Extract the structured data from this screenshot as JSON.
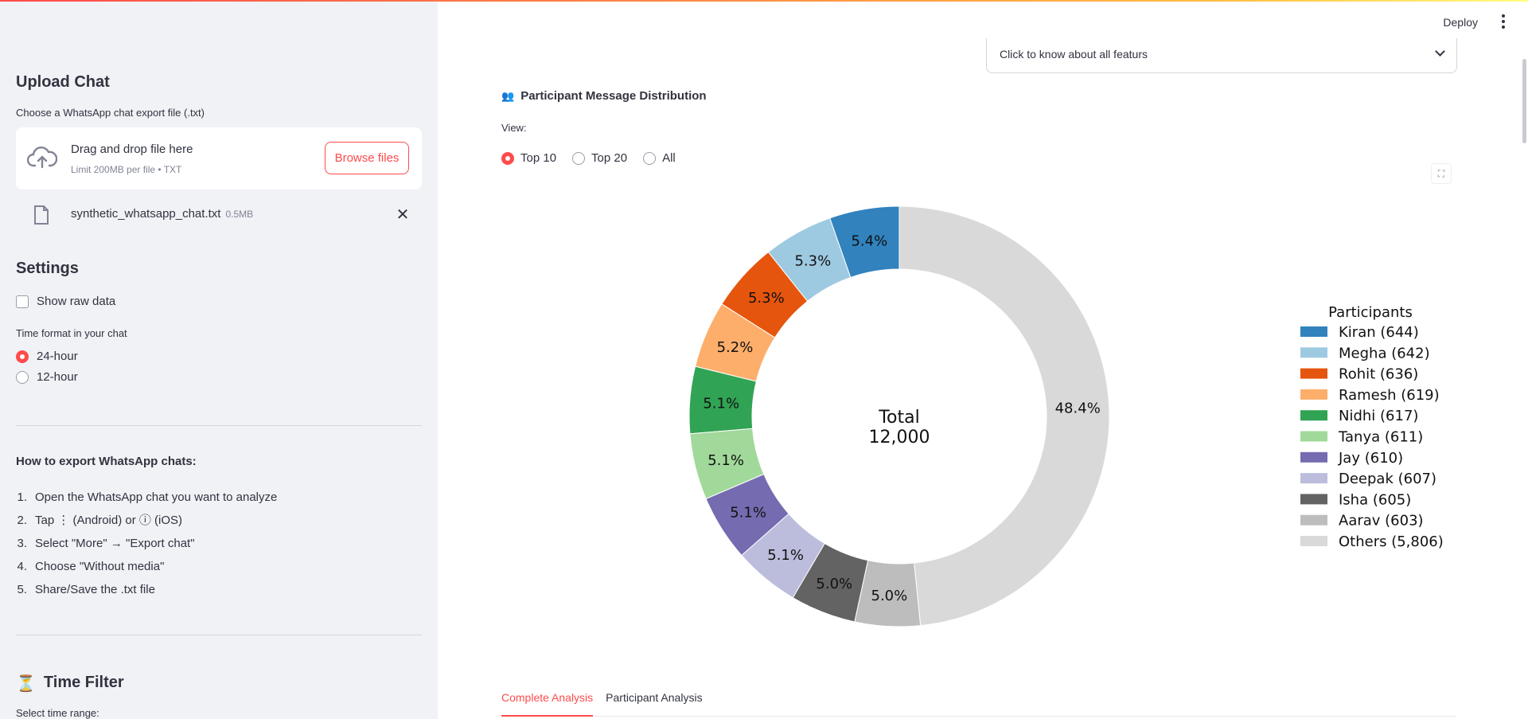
{
  "sidebar": {
    "upload_heading": "Upload Chat",
    "upload_label": "Choose a WhatsApp chat export file (.txt)",
    "dropzone_title": "Drag and drop file here",
    "dropzone_sub": "Limit 200MB per file • TXT",
    "browse_label": "Browse files",
    "file_name": "synthetic_whatsapp_chat.txt",
    "file_size": "0.5MB",
    "settings_heading": "Settings",
    "show_raw_label": "Show raw data",
    "time_format_label": "Time format in your chat",
    "time_options": [
      "24-hour",
      "12-hour"
    ],
    "time_selected": "24-hour",
    "export_heading": "How to export WhatsApp chats:",
    "steps": [
      "Open the WhatsApp chat you want to analyze",
      "Tap ⋮ (Android) or ⓘ (iOS)",
      "Select \"More\" → \"Export chat\"",
      "Choose \"Without media\"",
      "Share/Save the .txt file"
    ],
    "time_filter_heading": "Time Filter",
    "time_filter_icon": "⏳",
    "time_range_label": "Select time range:"
  },
  "header": {
    "deploy_label": "Deploy"
  },
  "main": {
    "expander_label": "Click to know about all featurs",
    "section_icon": "👥",
    "section_title": "Participant Message Distribution",
    "view_label": "View:",
    "view_options": [
      "Top 10",
      "Top 20",
      "All"
    ],
    "view_selected": "Top 10",
    "tabs": [
      "Complete Analysis",
      "Participant Analysis"
    ],
    "active_tab": "Complete Analysis"
  },
  "chart_data": {
    "type": "pie",
    "donut": true,
    "center_label": [
      "Total",
      "12,000"
    ],
    "legend_title": "Participants",
    "legend_position": "right",
    "slices": [
      {
        "name": "Kiran",
        "value": 644,
        "pct_label": "5.4%",
        "legend": "Kiran (644)",
        "color": "#3182bd"
      },
      {
        "name": "Megha",
        "value": 642,
        "pct_label": "5.3%",
        "legend": "Megha (642)",
        "color": "#9ecae1"
      },
      {
        "name": "Rohit",
        "value": 636,
        "pct_label": "5.3%",
        "legend": "Rohit (636)",
        "color": "#e6550d"
      },
      {
        "name": "Ramesh",
        "value": 619,
        "pct_label": "5.2%",
        "legend": "Ramesh (619)",
        "color": "#fdae6b"
      },
      {
        "name": "Nidhi",
        "value": 617,
        "pct_label": "5.1%",
        "legend": "Nidhi (617)",
        "color": "#31a354"
      },
      {
        "name": "Tanya",
        "value": 611,
        "pct_label": "5.1%",
        "legend": "Tanya (611)",
        "color": "#a1d99b"
      },
      {
        "name": "Jay",
        "value": 610,
        "pct_label": "5.1%",
        "legend": "Jay (610)",
        "color": "#756bb1"
      },
      {
        "name": "Deepak",
        "value": 607,
        "pct_label": "5.1%",
        "legend": "Deepak (607)",
        "color": "#bcbddc"
      },
      {
        "name": "Isha",
        "value": 605,
        "pct_label": "5.0%",
        "legend": "Isha (605)",
        "color": "#636363"
      },
      {
        "name": "Aarav",
        "value": 603,
        "pct_label": "5.0%",
        "legend": "Aarav (603)",
        "color": "#bdbdbd"
      },
      {
        "name": "Others",
        "value": 5806,
        "pct_label": "48.4%",
        "legend": "Others (5,806)",
        "color": "#d9d9d9"
      }
    ]
  }
}
